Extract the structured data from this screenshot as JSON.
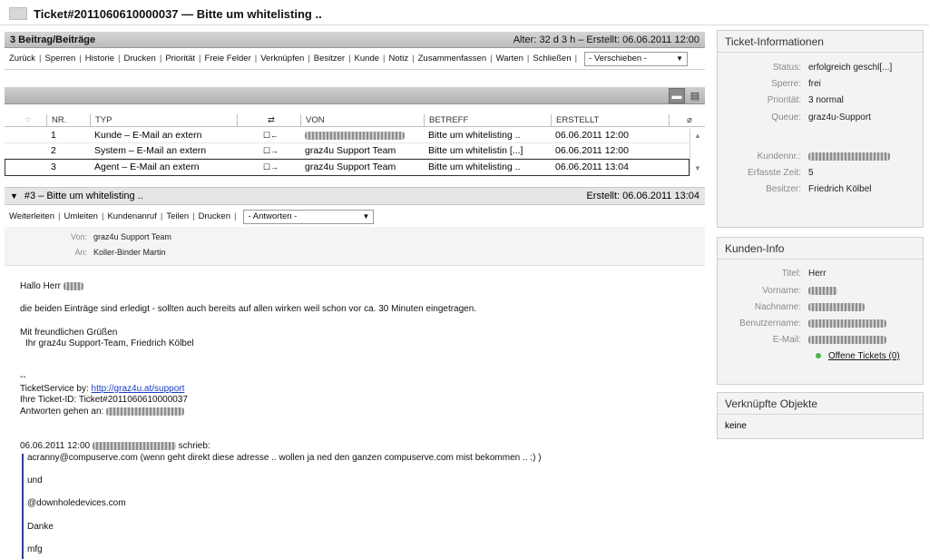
{
  "header": {
    "title": "Ticket#2011060610000037 — Bitte um whitelisting .."
  },
  "ticket_bar": {
    "count": "3 Beitrag/Beiträge",
    "age": "Alter: 32 d 3 h – Erstellt: 06.06.2011 12:00"
  },
  "actions": [
    "Zurück",
    "Sperren",
    "Historie",
    "Drucken",
    "Priorität",
    "Freie Felder",
    "Verknüpfen",
    "Besitzer",
    "Kunde",
    "Notiz",
    "Zusammenfassen",
    "Warten",
    "Schließen"
  ],
  "move_select": "- Verschieben -",
  "table": {
    "headers": [
      "NR.",
      "TYP",
      "⇄",
      "VON",
      "BETREFF",
      "ERSTELLT"
    ],
    "rows": [
      {
        "nr": "1",
        "typ": "Kunde – E-Mail an extern",
        "dir": "☐←",
        "von": "",
        "betreff": "Bitte um whitelisting ..",
        "erstellt": "06.06.2011 12:00"
      },
      {
        "nr": "2",
        "typ": "System – E-Mail an extern",
        "dir": "☐→",
        "von": "graz4u Support Team",
        "betreff": "Bitte um whitelistin [...]",
        "erstellt": "06.06.2011 12:00"
      },
      {
        "nr": "3",
        "typ": "Agent – E-Mail an extern",
        "dir": "☐→",
        "von": "graz4u Support Team",
        "betreff": "Bitte um whitelisting ..",
        "erstellt": "06.06.2011 13:04"
      }
    ]
  },
  "article": {
    "title": "#3 – Bitte um whitelisting ..",
    "created": "Erstellt: 06.06.2011 13:04",
    "actions": [
      "Weiterleiten",
      "Umleiten",
      "Kundenanruf",
      "Teilen",
      "Drucken"
    ],
    "reply_select": "- Antworten -",
    "from_label": "Von:",
    "from_value": "graz4u Support Team",
    "to_label": "An:",
    "to_value": "Koller-Binder Martin",
    "body": {
      "greeting": "Hallo Herr",
      "line1": "die beiden Einträge sind erledigt - sollten auch bereits auf allen wirken weil schon vor ca. 30 Minuten eingetragen.",
      "regards": "Mit freundlichen Grüßen",
      "signature": "Ihr graz4u Support-Team, Friedrich Kölbel",
      "dashes": "--",
      "service_prefix": "TicketService by: ",
      "service_link": "http://graz4u.at/support",
      "ticket_id": "Ihre Ticket-ID: Ticket#2011060610000037",
      "reply_to": "Antworten gehen an:",
      "quote_header_date": "06.06.2011 12:00",
      "quote_header_suffix": "schrieb:",
      "quote1": "acranny@compuserve.com (wenn geht direkt diese adresse .. wollen ja ned den ganzen compuserve.com mist bekommen .. :) )",
      "quote2": "und",
      "quote3": "@downholedevices.com",
      "quote4": "Danke",
      "quote5": "mfg"
    }
  },
  "ticket_info": {
    "title": "Ticket-Informationen",
    "status_label": "Status:",
    "status_value": "erfolgreich geschl[...]",
    "lock_label": "Sperre:",
    "lock_value": "frei",
    "priority_label": "Priorität:",
    "priority_value": "3 normal",
    "queue_label": "Queue:",
    "queue_value": "graz4u-Support",
    "customer_no_label": "Kundennr.:",
    "time_label": "Erfasste Zeit:",
    "time_value": "5",
    "owner_label": "Besitzer:",
    "owner_value": "Friedrich Kölbel"
  },
  "customer_info": {
    "title": "Kunden-Info",
    "salutation_label": "Titel:",
    "salutation_value": "Herr",
    "firstname_label": "Vorname:",
    "lastname_label": "Nachname:",
    "username_label": "Benutzername:",
    "email_label": "E-Mail:",
    "open_tickets": "Offene Tickets (0)"
  },
  "linked_objects": {
    "title": "Verknüpfte Objekte",
    "value": "keine"
  }
}
